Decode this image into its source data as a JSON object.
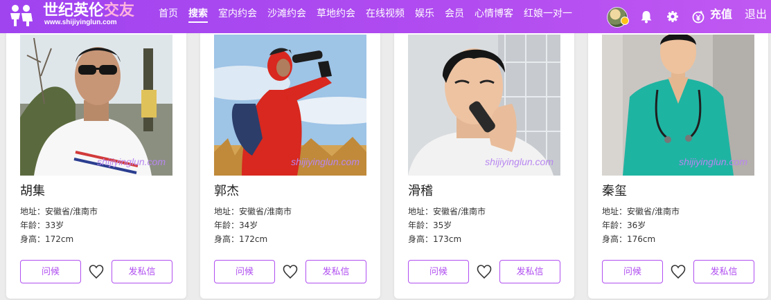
{
  "brand": {
    "name_main": "世纪英伦",
    "name_accent": "交友",
    "url": "www.shijiyinglun.com"
  },
  "nav": {
    "items": [
      {
        "label": "首页"
      },
      {
        "label": "搜索",
        "active": true
      },
      {
        "label": "室内约会"
      },
      {
        "label": "沙滩约会"
      },
      {
        "label": "草地约会"
      },
      {
        "label": "在线视频"
      },
      {
        "label": "娱乐"
      },
      {
        "label": "会员"
      },
      {
        "label": "心情博客"
      },
      {
        "label": "红娘一对一"
      }
    ],
    "recharge_label": "充值",
    "logout_label": "退出"
  },
  "colors": {
    "brand_purple": "#b04ef0",
    "watermark": "#b887f0"
  },
  "watermark_text": "shijiyinglun.com",
  "profiles": [
    {
      "name": "胡集",
      "address": "地址：安徽省/淮南市",
      "age": "年龄：33岁",
      "height": "身高：172cm",
      "greet_label": "问候",
      "message_label": "发私信",
      "photo_icon": "photo-man-sunglasses"
    },
    {
      "name": "郭杰",
      "address": "地址：安徽省/淮南市",
      "age": "年龄：34岁",
      "height": "身高：172cm",
      "greet_label": "问候",
      "message_label": "发私信",
      "photo_icon": "photo-man-red-jacket"
    },
    {
      "name": "滑稽",
      "address": "地址：安徽省/淮南市",
      "age": "年龄：35岁",
      "height": "身高：173cm",
      "greet_label": "问候",
      "message_label": "发私信",
      "photo_icon": "photo-man-shaving"
    },
    {
      "name": "秦玺",
      "address": "地址：安徽省/淮南市",
      "age": "年龄：36岁",
      "height": "身高：176cm",
      "greet_label": "问候",
      "message_label": "发私信",
      "photo_icon": "photo-man-scrubs"
    }
  ]
}
